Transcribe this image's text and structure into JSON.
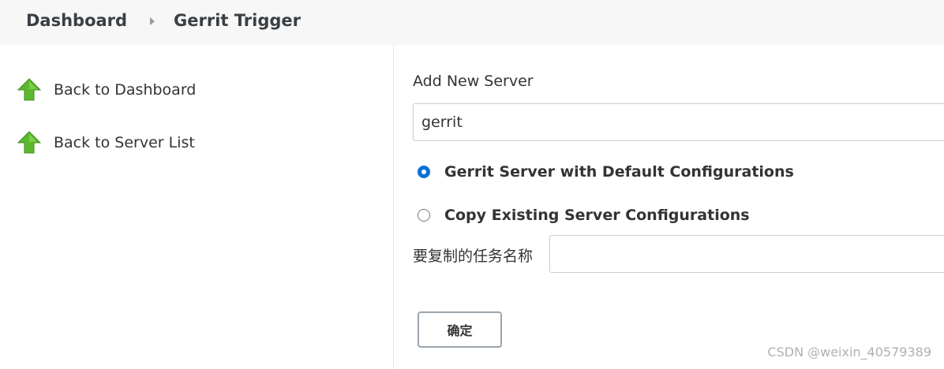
{
  "breadcrumb": {
    "items": [
      {
        "label": "Dashboard"
      },
      {
        "label": "Gerrit Trigger"
      }
    ],
    "separator_icon": "chevron-right-icon"
  },
  "sidebar": {
    "tasks": [
      {
        "label": "Back to Dashboard",
        "icon": "green-up-arrow-icon"
      },
      {
        "label": "Back to Server List",
        "icon": "green-up-arrow-icon"
      }
    ]
  },
  "form": {
    "title": "Add New Server",
    "name_value": "gerrit",
    "options": [
      {
        "label": "Gerrit Server with Default Configurations",
        "checked": true
      },
      {
        "label": "Copy Existing Server Configurations",
        "checked": false
      }
    ],
    "copy_label": "要复制的任务名称",
    "copy_value": "",
    "submit_label": "确定"
  },
  "watermark": "CSDN @weixin_40579389",
  "colors": {
    "header_bg": "#f7f7f7",
    "radio_checked": "#0a6fd8",
    "arrow_green": "#5cb82e"
  }
}
